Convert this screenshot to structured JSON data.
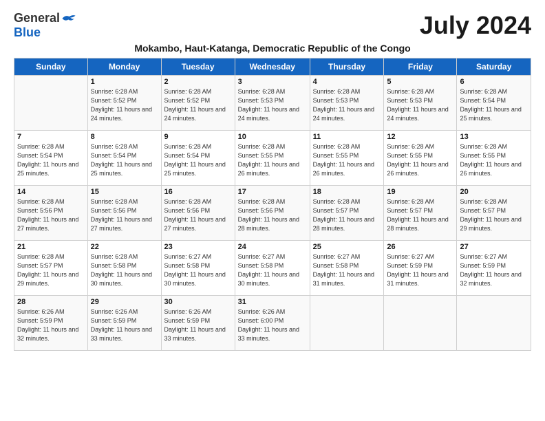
{
  "logo": {
    "general": "General",
    "blue": "Blue"
  },
  "title": "July 2024",
  "subtitle": "Mokambo, Haut-Katanga, Democratic Republic of the Congo",
  "header_days": [
    "Sunday",
    "Monday",
    "Tuesday",
    "Wednesday",
    "Thursday",
    "Friday",
    "Saturday"
  ],
  "weeks": [
    [
      {
        "day": "",
        "detail": ""
      },
      {
        "day": "1",
        "detail": "Sunrise: 6:28 AM\nSunset: 5:52 PM\nDaylight: 11 hours\nand 24 minutes."
      },
      {
        "day": "2",
        "detail": "Sunrise: 6:28 AM\nSunset: 5:52 PM\nDaylight: 11 hours\nand 24 minutes."
      },
      {
        "day": "3",
        "detail": "Sunrise: 6:28 AM\nSunset: 5:53 PM\nDaylight: 11 hours\nand 24 minutes."
      },
      {
        "day": "4",
        "detail": "Sunrise: 6:28 AM\nSunset: 5:53 PM\nDaylight: 11 hours\nand 24 minutes."
      },
      {
        "day": "5",
        "detail": "Sunrise: 6:28 AM\nSunset: 5:53 PM\nDaylight: 11 hours\nand 24 minutes."
      },
      {
        "day": "6",
        "detail": "Sunrise: 6:28 AM\nSunset: 5:54 PM\nDaylight: 11 hours\nand 25 minutes."
      }
    ],
    [
      {
        "day": "7",
        "detail": "Sunrise: 6:28 AM\nSunset: 5:54 PM\nDaylight: 11 hours\nand 25 minutes."
      },
      {
        "day": "8",
        "detail": "Sunrise: 6:28 AM\nSunset: 5:54 PM\nDaylight: 11 hours\nand 25 minutes."
      },
      {
        "day": "9",
        "detail": "Sunrise: 6:28 AM\nSunset: 5:54 PM\nDaylight: 11 hours\nand 25 minutes."
      },
      {
        "day": "10",
        "detail": "Sunrise: 6:28 AM\nSunset: 5:55 PM\nDaylight: 11 hours\nand 26 minutes."
      },
      {
        "day": "11",
        "detail": "Sunrise: 6:28 AM\nSunset: 5:55 PM\nDaylight: 11 hours\nand 26 minutes."
      },
      {
        "day": "12",
        "detail": "Sunrise: 6:28 AM\nSunset: 5:55 PM\nDaylight: 11 hours\nand 26 minutes."
      },
      {
        "day": "13",
        "detail": "Sunrise: 6:28 AM\nSunset: 5:55 PM\nDaylight: 11 hours\nand 26 minutes."
      }
    ],
    [
      {
        "day": "14",
        "detail": "Sunrise: 6:28 AM\nSunset: 5:56 PM\nDaylight: 11 hours\nand 27 minutes."
      },
      {
        "day": "15",
        "detail": "Sunrise: 6:28 AM\nSunset: 5:56 PM\nDaylight: 11 hours\nand 27 minutes."
      },
      {
        "day": "16",
        "detail": "Sunrise: 6:28 AM\nSunset: 5:56 PM\nDaylight: 11 hours\nand 27 minutes."
      },
      {
        "day": "17",
        "detail": "Sunrise: 6:28 AM\nSunset: 5:56 PM\nDaylight: 11 hours\nand 28 minutes."
      },
      {
        "day": "18",
        "detail": "Sunrise: 6:28 AM\nSunset: 5:57 PM\nDaylight: 11 hours\nand 28 minutes."
      },
      {
        "day": "19",
        "detail": "Sunrise: 6:28 AM\nSunset: 5:57 PM\nDaylight: 11 hours\nand 28 minutes."
      },
      {
        "day": "20",
        "detail": "Sunrise: 6:28 AM\nSunset: 5:57 PM\nDaylight: 11 hours\nand 29 minutes."
      }
    ],
    [
      {
        "day": "21",
        "detail": "Sunrise: 6:28 AM\nSunset: 5:57 PM\nDaylight: 11 hours\nand 29 minutes."
      },
      {
        "day": "22",
        "detail": "Sunrise: 6:28 AM\nSunset: 5:58 PM\nDaylight: 11 hours\nand 30 minutes."
      },
      {
        "day": "23",
        "detail": "Sunrise: 6:27 AM\nSunset: 5:58 PM\nDaylight: 11 hours\nand 30 minutes."
      },
      {
        "day": "24",
        "detail": "Sunrise: 6:27 AM\nSunset: 5:58 PM\nDaylight: 11 hours\nand 30 minutes."
      },
      {
        "day": "25",
        "detail": "Sunrise: 6:27 AM\nSunset: 5:58 PM\nDaylight: 11 hours\nand 31 minutes."
      },
      {
        "day": "26",
        "detail": "Sunrise: 6:27 AM\nSunset: 5:59 PM\nDaylight: 11 hours\nand 31 minutes."
      },
      {
        "day": "27",
        "detail": "Sunrise: 6:27 AM\nSunset: 5:59 PM\nDaylight: 11 hours\nand 32 minutes."
      }
    ],
    [
      {
        "day": "28",
        "detail": "Sunrise: 6:26 AM\nSunset: 5:59 PM\nDaylight: 11 hours\nand 32 minutes."
      },
      {
        "day": "29",
        "detail": "Sunrise: 6:26 AM\nSunset: 5:59 PM\nDaylight: 11 hours\nand 33 minutes."
      },
      {
        "day": "30",
        "detail": "Sunrise: 6:26 AM\nSunset: 5:59 PM\nDaylight: 11 hours\nand 33 minutes."
      },
      {
        "day": "31",
        "detail": "Sunrise: 6:26 AM\nSunset: 6:00 PM\nDaylight: 11 hours\nand 33 minutes."
      },
      {
        "day": "",
        "detail": ""
      },
      {
        "day": "",
        "detail": ""
      },
      {
        "day": "",
        "detail": ""
      }
    ]
  ]
}
